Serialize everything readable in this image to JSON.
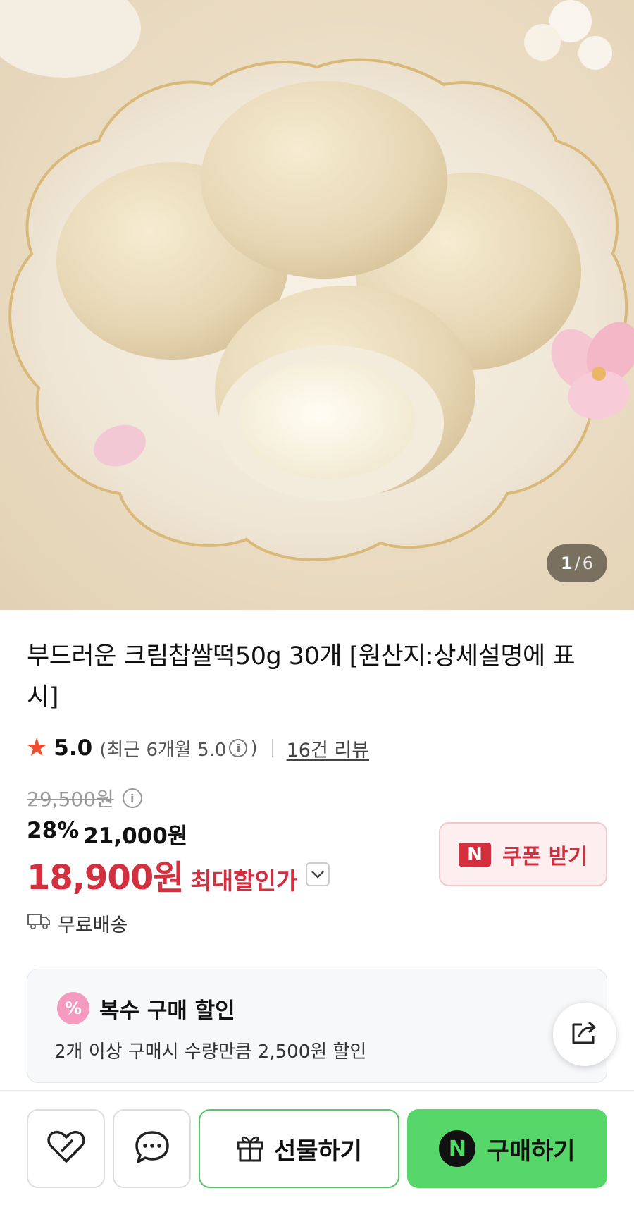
{
  "gallery": {
    "current": "1",
    "separator": "/",
    "total": "6"
  },
  "product": {
    "title": "부드러운 크림찹쌀떡50g 30개 [원산지:상세설명에 표시]"
  },
  "rating": {
    "score": "5.0",
    "recent_prefix": "(최근 6개월 5.0",
    "recent_suffix": ")",
    "reviews_link": "16건 리뷰"
  },
  "price": {
    "original": "29,500원",
    "discount_rate": "28%",
    "sale_price": "21,000원",
    "max_discount_price": "18,900원",
    "max_discount_label": "최대할인가"
  },
  "coupon": {
    "badge": "N",
    "label": "쿠폰 받기"
  },
  "shipping": {
    "label": "무료배송"
  },
  "promo": {
    "icon_text": "%",
    "title": "복수 구매 할인",
    "description": "2개 이상 구매시 수량만큼 2,500원 할인"
  },
  "bottom_bar": {
    "gift_label": "선물하기",
    "buy_badge": "N",
    "buy_label": "구매하기"
  },
  "colors": {
    "accent_red": "#d32f3f",
    "star": "#ef4e2f",
    "buy_green": "#57d66a",
    "gift_border": "#57c866"
  }
}
